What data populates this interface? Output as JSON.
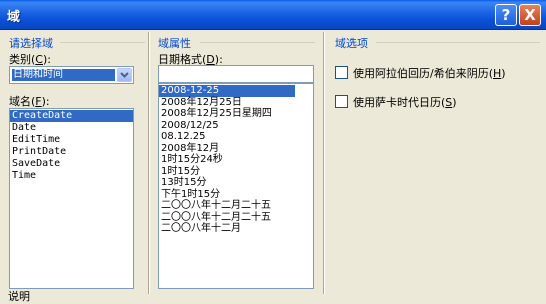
{
  "window": {
    "title": "域",
    "help_label": "?",
    "close_label": "X"
  },
  "left_panel": {
    "section_title": "请选择域",
    "category_label": "类别",
    "category_hotkey": "C",
    "category_suffix": "):",
    "category_value": "日期和时间",
    "field_names_label": "域名",
    "field_names_hotkey": "F",
    "field_names_suffix": "):",
    "field_names": [
      "CreateDate",
      "Date",
      "EditTime",
      "PrintDate",
      "SaveDate",
      "Time"
    ],
    "bottom_text": "说明"
  },
  "middle_panel": {
    "section_title": "域属性",
    "date_format_label": "日期格式",
    "date_format_hotkey": "D",
    "date_format_suffix": "):",
    "date_format_value": "",
    "formats": [
      "2008-12-25",
      "2008年12月25日",
      "2008年12月25日星期四",
      "2008/12/25",
      "08.12.25",
      "2008年12月",
      "1时15分24秒",
      "1时15分",
      "13时15分",
      "下午1时15分",
      "二〇〇八年十二月二十五",
      "二〇〇八年十二月二十五",
      "二〇〇八年十二月"
    ]
  },
  "right_panel": {
    "section_title": "域选项",
    "options": [
      {
        "label": "使用阿拉伯回历/希伯来阴历",
        "hotkey": "H",
        "checked": false
      },
      {
        "label": "使用萨卡时代日历",
        "hotkey": "S",
        "checked": false
      }
    ]
  }
}
